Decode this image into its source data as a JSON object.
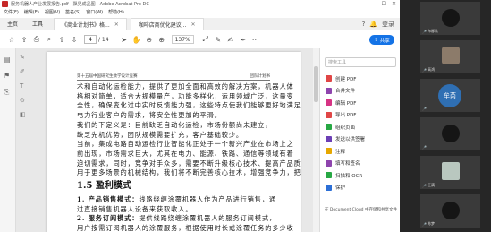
{
  "window": {
    "title": "服务机器人产业发展报告.pdf - 飘晃成品图 - Adobe Acrobat Pro DC",
    "controls": [
      "—",
      "☐",
      "✕"
    ]
  },
  "menu": [
    "文件(F)",
    "编辑(E)",
    "视图(V)",
    "签名(S)",
    "窗口(W)",
    "帮助(H)"
  ],
  "tabs": {
    "home": "主页",
    "tools": "工具",
    "document": "《商业计划书》格...",
    "document2": "咖啡店商优化建议...",
    "login": "登录"
  },
  "toolbar": {
    "page_current": "4",
    "page_total": "/ 14",
    "zoom": "137%",
    "share_label": "共享"
  },
  "page": {
    "header_left": "第十五届中国研究生数学设计竞赛",
    "header_right": "团队计划书",
    "body_lines": [
      "术和自动化运检能力，提供了更加全面和高效的解决方案，机器人体",
      "格相对简单，适合大规模量产，功能多样化，运用领域广泛，这量变",
      "全性，确保变化过中实时反馈能力强，这些特点使我们能够更好地满足",
      "电力行业客户的需求，将安全性更加的平滑。",
      "  我们的下定义是：目前缺乏自动化运检，市场份额尚未建立，",
      "缺乏先机优势，团队规模需要扩充，客户基础较少。",
      "  当前，集成电路自动运检行业智能化正处于一个新兴产业在市场上之",
      "前出现，市场需求巨大，尤其在电力、能源、铁路、通信等领域有着",
      "迫切需求，同时，竞争对手众多，需要不断升级核心技术、提高产品质量，",
      "用于更多场景的机械结构，我们将不断完善核心技术，增强竞争力，把",
      "握机遇！"
    ],
    "section_title": "1.5 盈利模式",
    "list_items": [
      {
        "label": "1. 产品销售模式：",
        "text": "线路绕缠涂覆机器人作为产品进行销售，通"
      },
      {
        "label": "",
        "text": "过直接销售机器人设备来获取收入。"
      },
      {
        "label": "2. 服务订阅模式：",
        "text": "提供线路绕缠涂覆机器人的服务订阅模式，"
      },
      {
        "label": "",
        "text": "用户按需订阅机器人的涂覆服务，根据使用时长或涂覆任务的多少收"
      }
    ]
  },
  "tool_panel": {
    "search_placeholder": "搜索工具",
    "items": [
      {
        "label": "创建 PDF",
        "icon": "create-pdf-icon",
        "color": "#e04646"
      },
      {
        "label": "合并文件",
        "icon": "combine-files-icon",
        "color": "#8e44ad"
      },
      {
        "label": "编辑 PDF",
        "icon": "edit-pdf-icon",
        "color": "#d63384"
      },
      {
        "label": "导出 PDF",
        "icon": "export-pdf-icon",
        "color": "#e04646"
      },
      {
        "label": "组织页面",
        "icon": "organize-pages-icon",
        "color": "#27a844"
      },
      {
        "label": "发送以供签署",
        "icon": "send-sign-icon",
        "color": "#6c3fb5"
      },
      {
        "label": "注释",
        "icon": "comment-icon",
        "color": "#e6a700"
      },
      {
        "label": "填写和签名",
        "icon": "fill-sign-icon",
        "color": "#8e44ad"
      },
      {
        "label": "扫描和 OCR",
        "icon": "scan-ocr-icon",
        "color": "#27a844"
      },
      {
        "label": "保护",
        "icon": "protect-icon",
        "color": "#2c6fd6"
      }
    ],
    "cloud_note": "在 Document Cloud 中存储和共享文件"
  },
  "participants": [
    {
      "name": "布娜欣",
      "avatar": "dark-circle"
    },
    {
      "name": "高鸿",
      "avatar": "photo"
    },
    {
      "name": "",
      "avatar": "text",
      "avatar_text": "牟芮"
    },
    {
      "name": "",
      "avatar": "dark-circle"
    },
    {
      "name": "王满",
      "avatar": "photo-square"
    },
    {
      "name": "苏梦",
      "avatar": "dark-circle"
    }
  ]
}
